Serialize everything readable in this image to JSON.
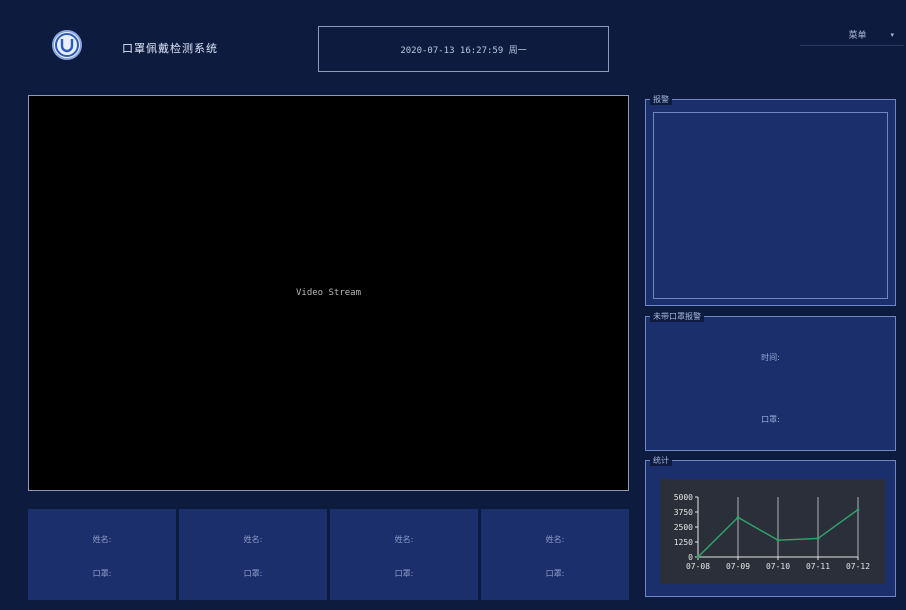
{
  "header": {
    "title": "口罩佩戴检测系统",
    "datetime": "2020-07-13 16:27:59 周一",
    "menu_label": "菜单",
    "menu_arrow": "▾"
  },
  "video": {
    "label": "Video Stream"
  },
  "cards": [
    {
      "name_label": "姓名:",
      "mask_label": "口罩:"
    },
    {
      "name_label": "姓名:",
      "mask_label": "口罩:"
    },
    {
      "name_label": "姓名:",
      "mask_label": "口罩:"
    },
    {
      "name_label": "姓名:",
      "mask_label": "口罩:"
    }
  ],
  "panels": {
    "alarm": {
      "title": "报警"
    },
    "nomask": {
      "title": "未带口罩报警",
      "time_label": "时间:",
      "mask_label": "口罩:"
    },
    "stats": {
      "title": "统计"
    }
  },
  "colors": {
    "line": "#2ea86a",
    "background": "#0d1b3e",
    "panel": "#1a2f6b"
  },
  "chart_data": {
    "type": "line",
    "categories": [
      "07-08",
      "07-09",
      "07-10",
      "07-11",
      "07-12"
    ],
    "values": [
      0,
      3300,
      1400,
      1550,
      3950
    ],
    "yticks": [
      "0",
      "1250",
      "2500",
      "3750",
      "5000"
    ],
    "ylim": [
      0,
      5000
    ],
    "grid": "vertical"
  }
}
